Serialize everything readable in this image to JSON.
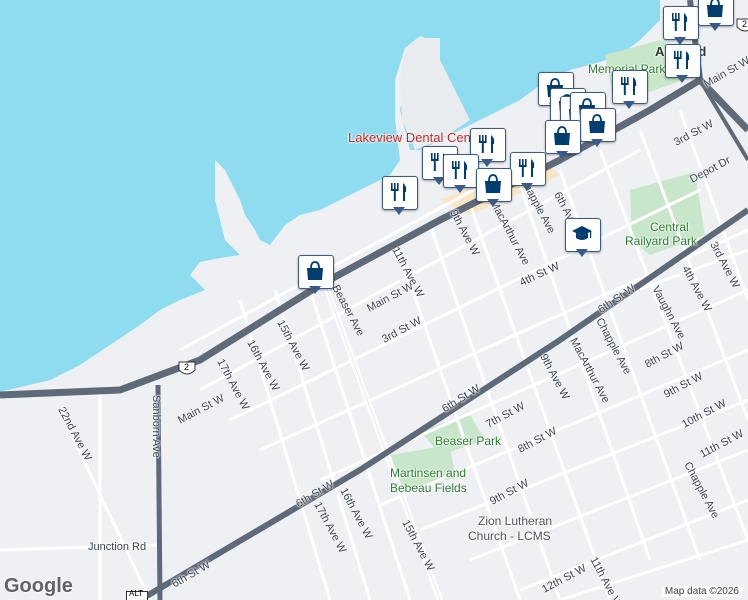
{
  "colors": {
    "water": "#8ddcef",
    "land": "#eef0f3",
    "park": "#c8e6c9",
    "street": "#ffffff",
    "street_edge": "#d3d7dd",
    "highway": "#5f6a78",
    "commercial": "#f7e7c6",
    "pin_border": "#3a5a8a",
    "pin_icon": "#003d70"
  },
  "labels": {
    "city": "Ashland",
    "memorial_park": "Memorial Park",
    "dental": "Lakeview Dental Center",
    "central_park_1": "Central",
    "central_park_2": "Railyard Park",
    "beaser_park": "Beaser Park",
    "fields_1": "Martinsen and",
    "fields_2": "Bebeau Fields",
    "church_1": "Zion Lutheran",
    "church_2": "Church - LCMS",
    "beaser_ave": "Beaser Ave",
    "sanborn_ave": "Sanborn Ave",
    "sixth_st_1": "6th St W",
    "sixth_st_2": "6th St W",
    "sixth_st_3": "6th St W",
    "sixth_st_4": "6th St W",
    "main_st_1": "Main St W",
    "main_st_2": "Main St W",
    "main_st_3": "Main St W",
    "third_st_1": "3rd St W",
    "third_st_2": "3rd St W",
    "fourth_st": "4th St W",
    "seventh_st": "7th St W",
    "eighth_st_1": "8th St W",
    "eighth_st_2": "8th St W",
    "ninth_st_1": "9th St W",
    "ninth_st_2": "9th St W",
    "tenth_st": "10th St W",
    "eleventh_st": "11th St W",
    "twelfth_st": "12th St W",
    "depot_dr": "Depot Dr",
    "junction_rd": "Junction Rd",
    "ave_22": "22nd Ave W",
    "ave_17a": "17th Ave W",
    "ave_17b": "17th Ave W",
    "ave_16a": "16th Ave W",
    "ave_16b": "16th Ave W",
    "ave_15a": "15th Ave W",
    "ave_15b": "15th Ave W",
    "ave_11a": "11th Ave W",
    "ave_11b": "11th Ave W",
    "ave_9a": "9th Ave W",
    "ave_9b": "9th Ave W",
    "ave_6": "6th Ave W",
    "ave_4": "4th Ave W",
    "ave_3": "3rd Ave W",
    "macarthur_1": "MacArthur Ave",
    "macarthur_2": "MacArthur Ave",
    "chapple_1": "Chapple Ave",
    "chapple_2": "Chapple Ave",
    "chapple_3": "Chapple Ave",
    "vaughn_ave": "Vaughn Ave",
    "hwy2_a": "2",
    "hwy2_b": "2",
    "alt": "ALT",
    "google": "Google",
    "map_data": "Map data ©2026"
  },
  "pins": [
    {
      "icon": "restaurant",
      "label": ""
    },
    {
      "icon": "shopping",
      "label": ""
    },
    {
      "icon": "restaurant",
      "label": ""
    },
    {
      "icon": "shopping",
      "label": ""
    },
    {
      "icon": "shopping",
      "label": ""
    },
    {
      "icon": "shopping",
      "label": ""
    },
    {
      "icon": "shopping",
      "label": ""
    },
    {
      "icon": "restaurant",
      "label": ""
    },
    {
      "icon": "restaurant",
      "label": ""
    },
    {
      "icon": "shopping",
      "label": ""
    },
    {
      "icon": "restaurant",
      "label": ""
    },
    {
      "icon": "shopping",
      "label": ""
    },
    {
      "icon": "restaurant",
      "label": ""
    },
    {
      "icon": "restaurant",
      "label": ""
    },
    {
      "icon": "shopping",
      "label": ""
    },
    {
      "icon": "restaurant",
      "label": ""
    },
    {
      "icon": "shopping",
      "label": ""
    },
    {
      "icon": "school",
      "label": ""
    }
  ]
}
